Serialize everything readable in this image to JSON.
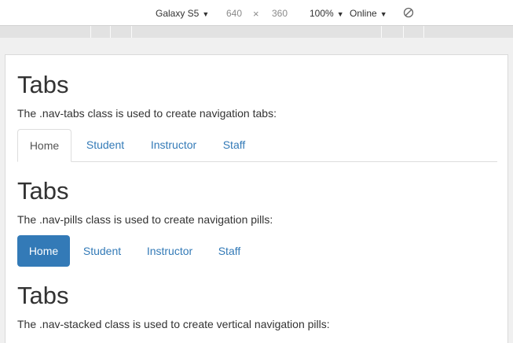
{
  "toolbar": {
    "device": "Galaxy S5",
    "width": "640",
    "times": "×",
    "height": "360",
    "zoom": "100%",
    "network": "Online",
    "rotate_icon": "rotate-icon"
  },
  "sections": [
    {
      "title": "Tabs",
      "description": "The .nav-tabs class is used to create navigation tabs:",
      "items": [
        "Home",
        "Student",
        "Instructor",
        "Staff"
      ],
      "active": "Home"
    },
    {
      "title": "Tabs",
      "description": "The .nav-pills class is used to create navigation pills:",
      "items": [
        "Home",
        "Student",
        "Instructor",
        "Staff"
      ],
      "active": "Home"
    },
    {
      "title": "Tabs",
      "description": "The .nav-stacked class is used to create vertical navigation pills:"
    }
  ],
  "colors": {
    "link": "#337ab7",
    "active_pill_bg": "#337ab7",
    "text": "#333333"
  }
}
